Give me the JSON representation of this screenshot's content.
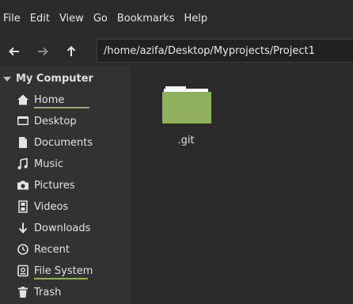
{
  "menu": [
    "File",
    "Edit",
    "View",
    "Go",
    "Bookmarks",
    "Help"
  ],
  "toolbar": {
    "back_icon": "arrow-left-icon",
    "forward_icon": "arrow-right-icon",
    "up_icon": "arrow-up-icon",
    "path": "/home/azifa/Desktop/Myprojects/Project1"
  },
  "sidebar": {
    "section": "My Computer",
    "items": [
      {
        "label": "Home",
        "icon": "home-icon"
      },
      {
        "label": "Desktop",
        "icon": "desktop-icon"
      },
      {
        "label": "Documents",
        "icon": "documents-icon"
      },
      {
        "label": "Music",
        "icon": "music-icon"
      },
      {
        "label": "Pictures",
        "icon": "camera-icon"
      },
      {
        "label": "Videos",
        "icon": "film-icon"
      },
      {
        "label": "Downloads",
        "icon": "download-icon"
      },
      {
        "label": "Recent",
        "icon": "clock-icon"
      },
      {
        "label": "File System",
        "icon": "drive-icon"
      },
      {
        "label": "Trash",
        "icon": "trash-icon"
      }
    ]
  },
  "files": [
    {
      "name": ".git",
      "icon": "folder-icon"
    }
  ],
  "colors": {
    "accent": "#8fb05c",
    "folder": "#8fb05c"
  }
}
